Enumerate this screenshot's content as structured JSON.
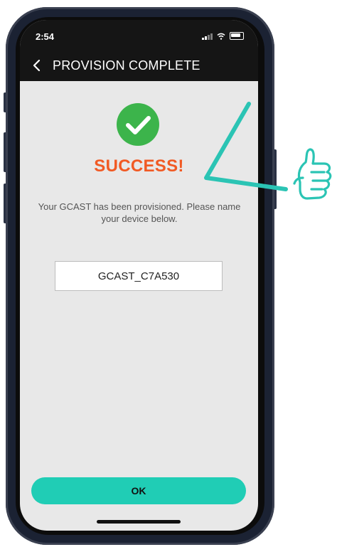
{
  "status_bar": {
    "time": "2:54",
    "icons": [
      "cellular-signal-icon",
      "wifi-icon",
      "battery-icon"
    ]
  },
  "nav": {
    "back_icon": "chevron-left-icon",
    "title": "PROVISION COMPLETE"
  },
  "content": {
    "status_icon": "check-circle-icon",
    "heading": "SUCCESS!",
    "message": "Your GCAST has been provisioned. Please name your device below.",
    "device_name_value": "GCAST_C7A530"
  },
  "actions": {
    "ok_label": "OK"
  },
  "annotation": {
    "icon": "thumbs-up-icon",
    "mark": "checkmark-stroke"
  },
  "colors": {
    "header_bg": "#151515",
    "screen_bg": "#e8e8e8",
    "success_green": "#3cb44b",
    "heading_orange": "#f15a24",
    "accent_teal": "#20cdb5",
    "phone_frame": "#1b2233"
  }
}
